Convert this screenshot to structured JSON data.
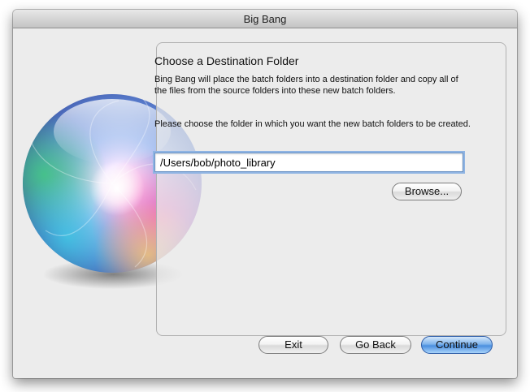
{
  "window": {
    "title": "Big Bang"
  },
  "step": {
    "heading": "Choose a Destination Folder",
    "description": "Bing Bang will place the batch folders into a destination folder and copy all of the files from the source folders into these new batch folders.",
    "prompt": "Please choose the folder in which you want the new batch folders to be created."
  },
  "destination": {
    "path_value": "/Users/bob/photo_library",
    "browse_label": "Browse..."
  },
  "footer": {
    "exit_label": "Exit",
    "back_label": "Go Back",
    "continue_label": "Continue"
  },
  "icons": {
    "logo": "big-bang-orb-icon"
  },
  "colors": {
    "accent": "#4b8fdf",
    "window_bg": "#ececec",
    "focus_ring": "#8fb4e3"
  }
}
